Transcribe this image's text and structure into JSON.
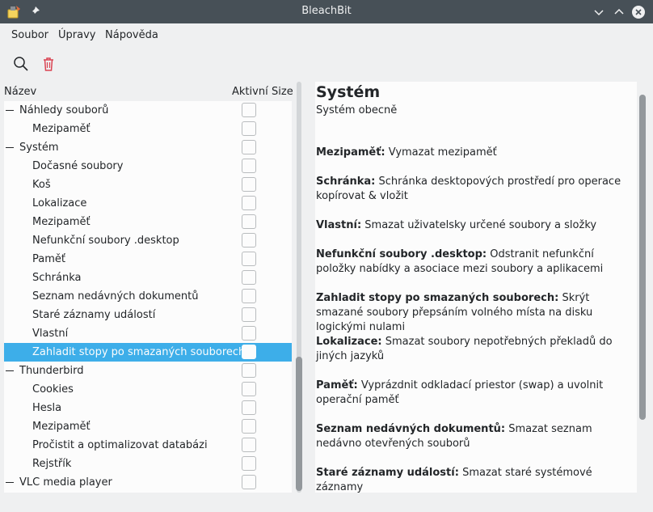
{
  "window": {
    "title": "BleachBit"
  },
  "menu": {
    "file": "Soubor",
    "edit": "Úpravy",
    "help": "Nápověda"
  },
  "toolbar": {
    "preview_icon": "search-icon",
    "clean_icon": "trash-icon",
    "clean_color": "#da4453"
  },
  "columns": {
    "name": "Název",
    "active": "Aktivní",
    "size": "Size"
  },
  "tree": [
    {
      "label": "Náhledy souborů",
      "level": 0,
      "checked": false,
      "selected": false
    },
    {
      "label": "Mezipaměť",
      "level": 1,
      "checked": false,
      "selected": false
    },
    {
      "label": "Systém",
      "level": 0,
      "checked": false,
      "selected": false
    },
    {
      "label": "Dočasné soubory",
      "level": 1,
      "checked": false,
      "selected": false
    },
    {
      "label": "Koš",
      "level": 1,
      "checked": false,
      "selected": false
    },
    {
      "label": "Lokalizace",
      "level": 1,
      "checked": false,
      "selected": false
    },
    {
      "label": "Mezipaměť",
      "level": 1,
      "checked": false,
      "selected": false
    },
    {
      "label": "Nefunkční soubory .desktop",
      "level": 1,
      "checked": false,
      "selected": false
    },
    {
      "label": "Paměť",
      "level": 1,
      "checked": false,
      "selected": false
    },
    {
      "label": "Schránka",
      "level": 1,
      "checked": false,
      "selected": false
    },
    {
      "label": "Seznam nedávných dokumentů",
      "level": 1,
      "checked": false,
      "selected": false
    },
    {
      "label": "Staré záznamy událostí",
      "level": 1,
      "checked": false,
      "selected": false
    },
    {
      "label": "Vlastní",
      "level": 1,
      "checked": false,
      "selected": false
    },
    {
      "label": "Zahladit stopy po smazaných souborech",
      "level": 1,
      "checked": false,
      "selected": true
    },
    {
      "label": "Thunderbird",
      "level": 0,
      "checked": false,
      "selected": false
    },
    {
      "label": "Cookies",
      "level": 1,
      "checked": false,
      "selected": false
    },
    {
      "label": "Hesla",
      "level": 1,
      "checked": false,
      "selected": false
    },
    {
      "label": "Mezipaměť",
      "level": 1,
      "checked": false,
      "selected": false
    },
    {
      "label": "Pročistit a optimalizovat databázi",
      "level": 1,
      "checked": false,
      "selected": false
    },
    {
      "label": "Rejstřík",
      "level": 1,
      "checked": false,
      "selected": false
    },
    {
      "label": "VLC media player",
      "level": 0,
      "checked": false,
      "selected": false
    }
  ],
  "description": {
    "heading": "Systém",
    "subheading": "Systém obecně",
    "entries": [
      {
        "name": "Mezipaměť:",
        "text": "Vymazat mezipaměť"
      },
      {
        "name": "Schránka:",
        "text": "Schránka desktopových prostředí pro operace kopírovat & vložit"
      },
      {
        "name": "Vlastní:",
        "text": "Smazat uživatelsky určené soubory a složky"
      },
      {
        "name": "Nefunkční soubory .desktop:",
        "text": "Odstranit nefunkční položky nabídky a asociace mezi soubory a aplikacemi"
      },
      {
        "name": "Zahladit stopy po smazaných souborech:",
        "text": "Skrýt smazané soubory přepsáním volného místa na disku logickými nulami"
      },
      {
        "name": "Lokalizace:",
        "text": "Smazat soubory nepotřebných překladů do jiných jazyků"
      },
      {
        "name": "Paměť:",
        "text": "Vyprázdnit odkladací priestor (swap) a uvolnit operační paměť"
      },
      {
        "name": "Seznam nedávných dokumentů:",
        "text": "Smazat seznam nedávno otevřených souborů"
      },
      {
        "name": "Staré záznamy událostí:",
        "text": "Smazat staré systémové záznamy"
      }
    ]
  },
  "colors": {
    "selection": "#3daee9",
    "titlebar": "#475057"
  }
}
